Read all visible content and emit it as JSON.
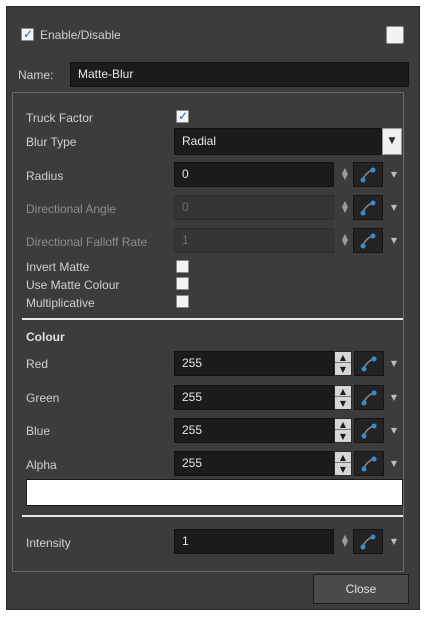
{
  "header": {
    "enable_label": "Enable/Disable",
    "enable_checked": true,
    "name_label": "Name:",
    "name_value": "Matte-Blur"
  },
  "params": {
    "truck_factor_label": "Truck Factor",
    "truck_factor_checked": true,
    "blur_type_label": "Blur Type",
    "blur_type_value": "Radial",
    "radius_label": "Radius",
    "radius_value": "0",
    "directional_angle_label": "Directional Angle",
    "directional_angle_value": "0",
    "falloff_label": "Directional Falloff Rate",
    "falloff_value": "1",
    "invert_matte_label": "Invert Matte",
    "use_matte_colour_label": "Use Matte Colour",
    "multiplicative_label": "Multiplicative"
  },
  "colour": {
    "section_label": "Colour",
    "red_label": "Red",
    "red_value": "255",
    "green_label": "Green",
    "green_value": "255",
    "blue_label": "Blue",
    "blue_value": "255",
    "alpha_label": "Alpha",
    "alpha_value": "255",
    "swatch_color": "#ffffff"
  },
  "intensity": {
    "label": "Intensity",
    "value": "1"
  },
  "footer": {
    "close_label": "Close"
  }
}
